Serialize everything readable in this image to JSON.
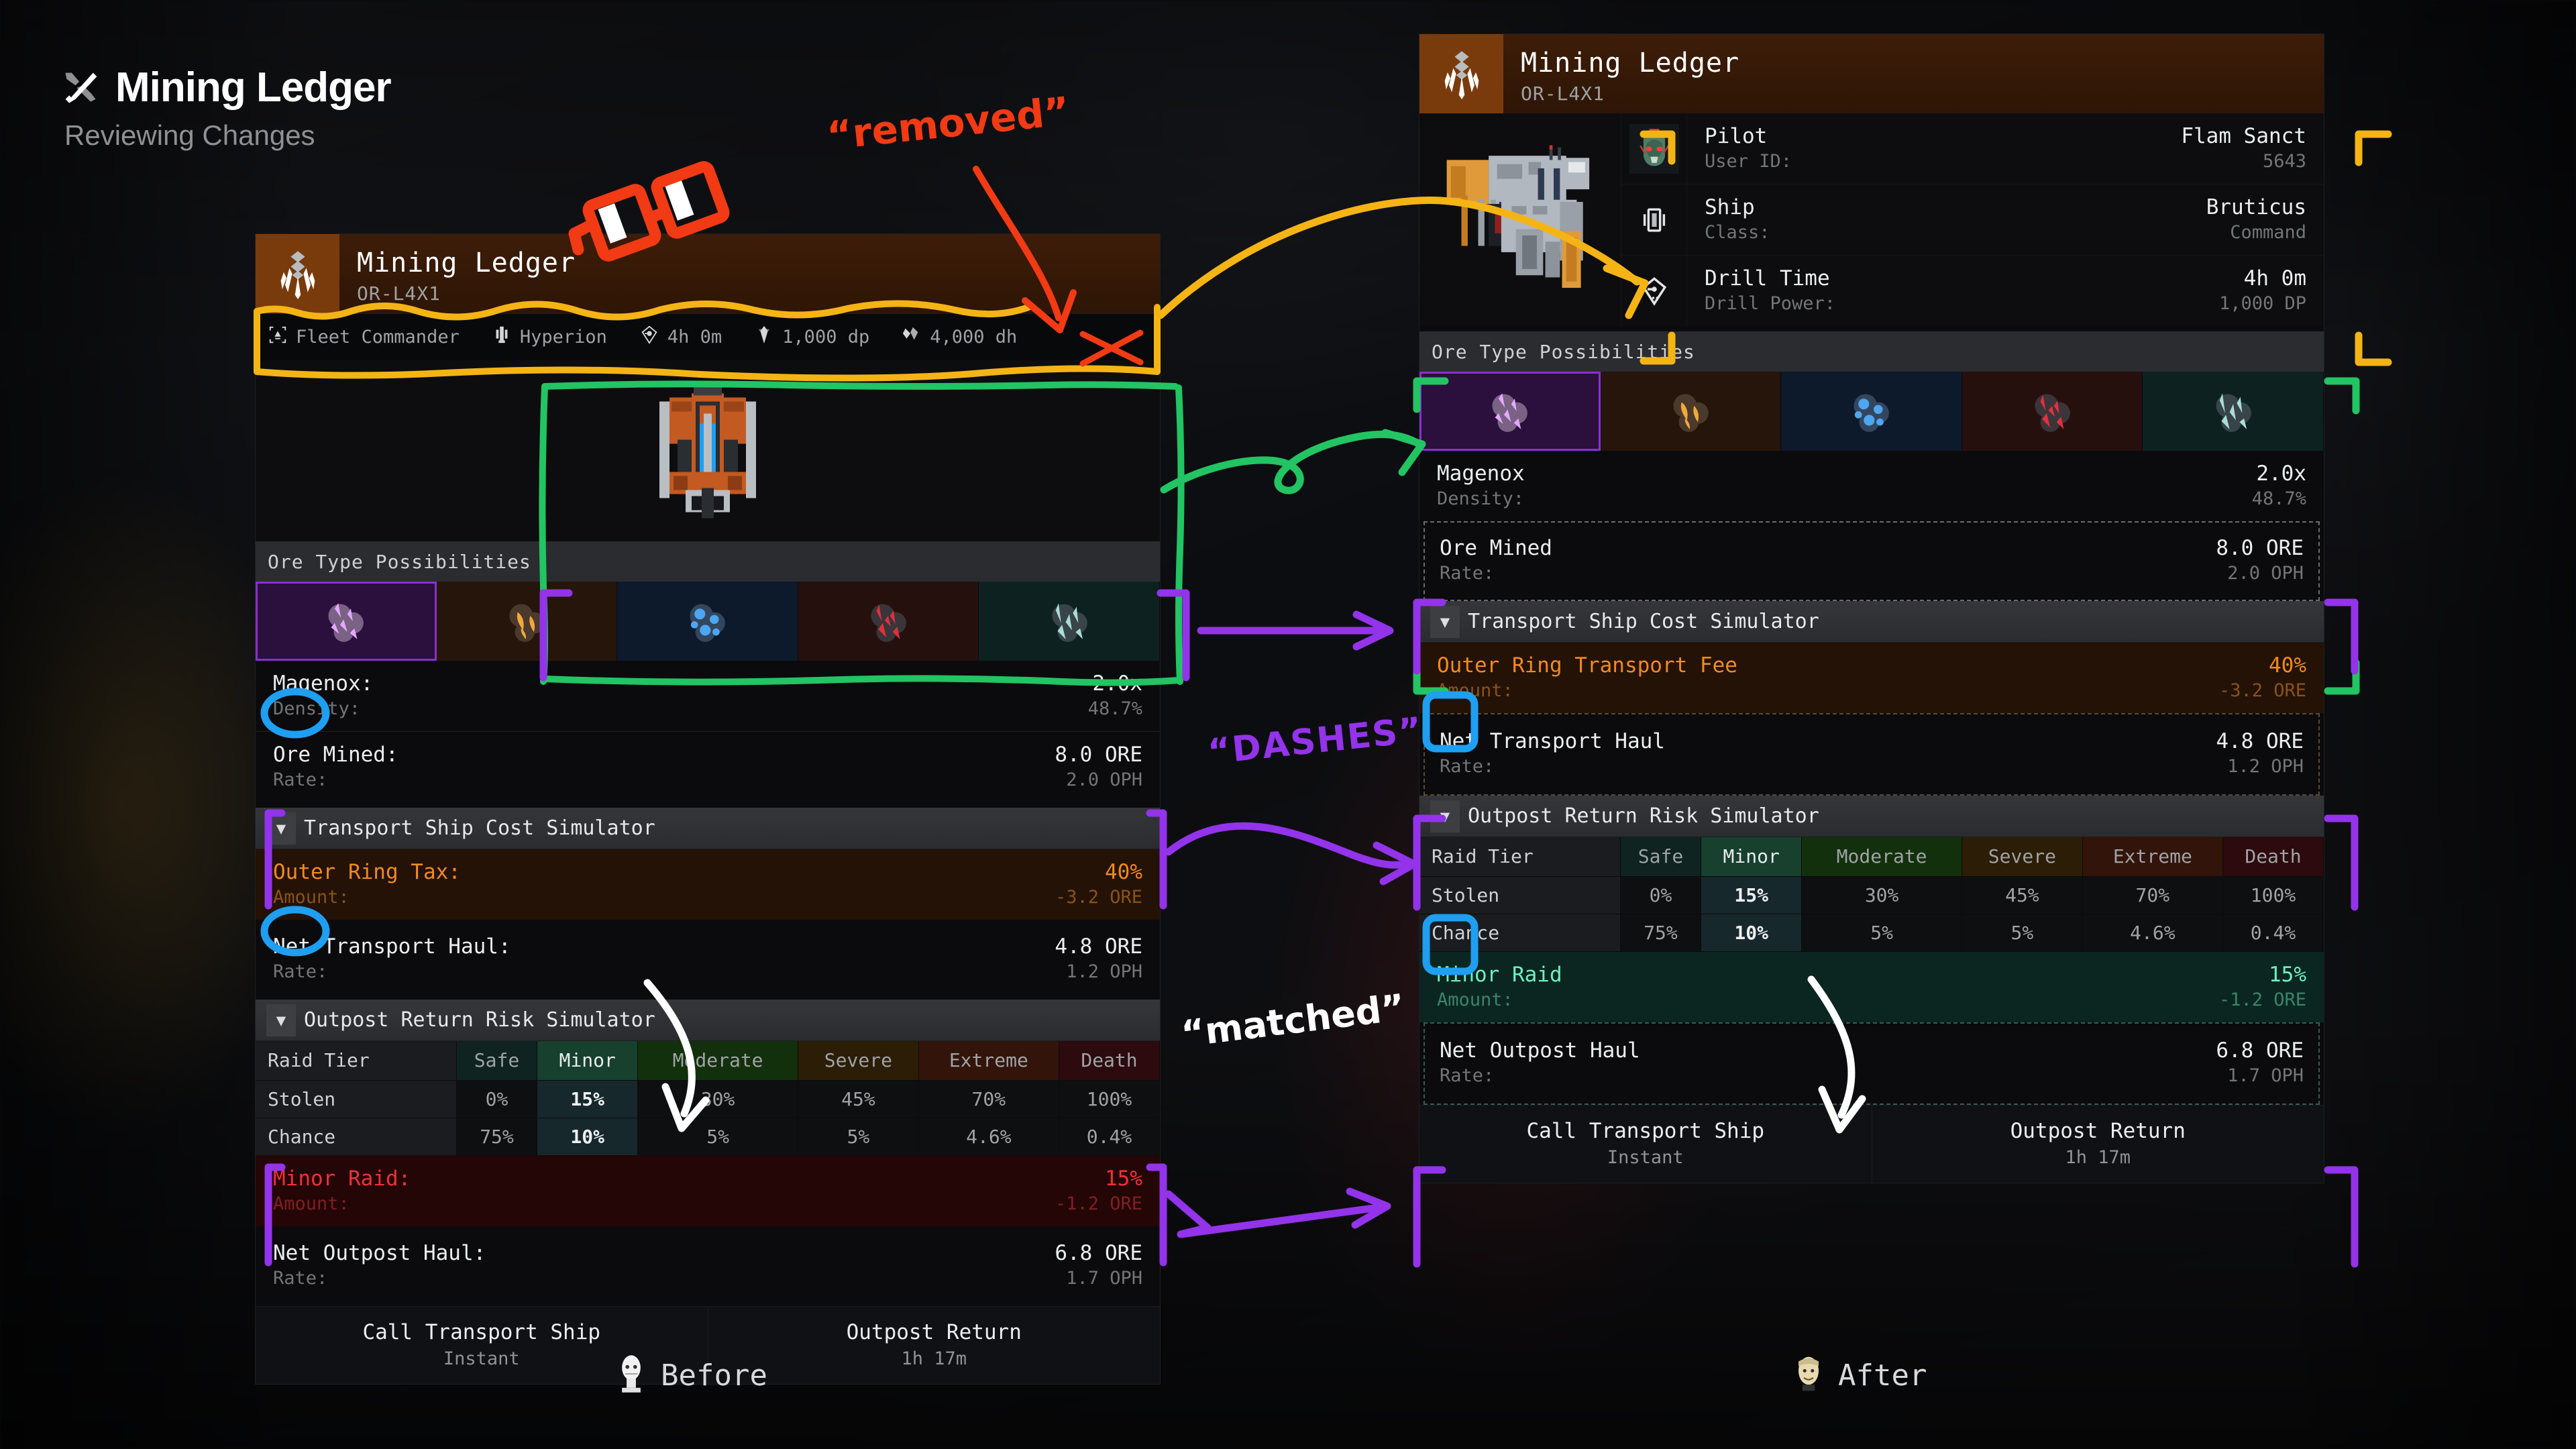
{
  "page": {
    "title": "Mining Ledger",
    "subtitle": "Reviewing Changes",
    "title_icon": "tools-icon"
  },
  "before": {
    "label": "Before",
    "icon": "ghost-statue-emoji",
    "header": {
      "title": "Mining Ledger",
      "subtitle": "OR-L4X1",
      "icon": "drill-crest-icon"
    },
    "statbar": [
      {
        "icon": "commander-badge-icon",
        "label": "Fleet Commander"
      },
      {
        "icon": "ship-icon",
        "label": "Hyperion"
      },
      {
        "icon": "drill-time-icon",
        "label": "4h 0m"
      },
      {
        "icon": "drill-power-icon",
        "label": "1,000 dp"
      },
      {
        "icon": "drill-hardness-icon",
        "label": "4,000 dh"
      }
    ],
    "ore_section": {
      "title": "Ore Type Possibilities",
      "tiles": [
        {
          "name": "magenox-ore",
          "color": "#c77ff0",
          "bg": "#2b0f3c",
          "selected": true
        },
        {
          "name": "goldrite-ore",
          "color": "#f0a93a",
          "bg": "#25150a",
          "selected": false
        },
        {
          "name": "cryovite-ore",
          "color": "#4da6f0",
          "bg": "#0d1a2c",
          "selected": false
        },
        {
          "name": "rubrex-ore",
          "color": "#e03040",
          "bg": "#26100e",
          "selected": false
        },
        {
          "name": "frostshard-ore",
          "color": "#9fd8d0",
          "bg": "#0d2220",
          "selected": false
        }
      ],
      "ore_name_label": "Magenox:",
      "ore_name_value": "2.0x",
      "density_label": "Density:",
      "density_value": "48.7%",
      "mined_label": "Ore Mined:",
      "mined_value": "8.0 ORE",
      "mined_rate_label": "Rate:",
      "mined_rate_value": "2.0 OPH"
    },
    "transport": {
      "section_title": "Transport Ship Cost Simulator",
      "fee_label": "Outer Ring Tax:",
      "fee_value": "40%",
      "amount_label": "Amount:",
      "amount_value": "-3.2 ORE",
      "net_label": "Net Transport Haul:",
      "net_value": "4.8 ORE",
      "net_rate_label": "Rate:",
      "net_rate_value": "1.2 OPH"
    },
    "risk": {
      "section_title": "Outpost Return Risk Simulator",
      "header_row": [
        "Raid Tier",
        "Safe",
        "Minor",
        "Moderate",
        "Severe",
        "Extreme",
        "Death"
      ],
      "rows": [
        {
          "label": "Stolen",
          "values": [
            "0%",
            "15%",
            "30%",
            "45%",
            "70%",
            "100%"
          ]
        },
        {
          "label": "Chance",
          "values": [
            "75%",
            "10%",
            "5%",
            "5%",
            "4.6%",
            "0.4%"
          ]
        }
      ],
      "selected_column": 2,
      "raid_label": "Minor Raid:",
      "raid_value": "15%",
      "raid_amount_label": "Amount:",
      "raid_amount_value": "-1.2 ORE",
      "net_label": "Net Outpost Haul:",
      "net_value": "6.8 ORE",
      "net_rate_label": "Rate:",
      "net_rate_value": "1.7 OPH"
    },
    "buttons": [
      {
        "label": "Call Transport Ship",
        "sub": "Instant"
      },
      {
        "label": "Outpost Return",
        "sub": "1h 17m"
      }
    ]
  },
  "after": {
    "label": "After",
    "icon": "face-emoji",
    "header": {
      "title": "Mining Ledger",
      "subtitle": "OR-L4X1",
      "icon": "drill-crest-icon"
    },
    "info_rows": [
      {
        "icon": "pilot-portrait",
        "label": "Pilot",
        "value": "Flam Sanct",
        "sub_label": "User ID:",
        "sub_value": "5643"
      },
      {
        "icon": "ship-icon",
        "label": "Ship",
        "value": "Bruticus",
        "sub_label": "Class:",
        "sub_value": "Command"
      },
      {
        "icon": "drill-time-icon",
        "label": "Drill Time",
        "value": "4h 0m",
        "sub_label": "Drill Power:",
        "sub_value": "1,000 DP"
      }
    ],
    "ore_section": {
      "title": "Ore Type Possibilities",
      "tiles": [
        {
          "name": "magenox-ore",
          "color": "#c77ff0",
          "bg": "#2b0f3c",
          "selected": true
        },
        {
          "name": "goldrite-ore",
          "color": "#f0a93a",
          "bg": "#25150a",
          "selected": false
        },
        {
          "name": "cryovite-ore",
          "color": "#4da6f0",
          "bg": "#0d1a2c",
          "selected": false
        },
        {
          "name": "rubrex-ore",
          "color": "#e03040",
          "bg": "#26100e",
          "selected": false
        },
        {
          "name": "frostshard-ore",
          "color": "#9fd8d0",
          "bg": "#0d2220",
          "selected": false
        }
      ],
      "ore_name_label": "Magenox",
      "ore_name_value": "2.0x",
      "density_label": "Density:",
      "density_value": "48.7%",
      "mined_label": "Ore Mined",
      "mined_value": "8.0 ORE",
      "mined_rate_label": "Rate:",
      "mined_rate_value": "2.0 OPH"
    },
    "transport": {
      "section_title": "Transport Ship Cost Simulator",
      "fee_label": "Outer Ring Transport Fee",
      "fee_value": "40%",
      "amount_label": "Amount:",
      "amount_value": "-3.2 ORE",
      "net_label": "Net Transport Haul",
      "net_value": "4.8 ORE",
      "net_rate_label": "Rate:",
      "net_rate_value": "1.2 OPH"
    },
    "risk": {
      "section_title": "Outpost Return Risk Simulator",
      "header_row": [
        "Raid Tier",
        "Safe",
        "Minor",
        "Moderate",
        "Severe",
        "Extreme",
        "Death"
      ],
      "rows": [
        {
          "label": "Stolen",
          "values": [
            "0%",
            "15%",
            "30%",
            "45%",
            "70%",
            "100%"
          ]
        },
        {
          "label": "Chance",
          "values": [
            "75%",
            "10%",
            "5%",
            "5%",
            "4.6%",
            "0.4%"
          ]
        }
      ],
      "selected_column": 2,
      "raid_label": "Minor Raid",
      "raid_value": "15%",
      "raid_amount_label": "Amount:",
      "raid_amount_value": "-1.2 ORE",
      "net_label": "Net Outpost Haul",
      "net_value": "6.8 ORE",
      "net_rate_label": "Rate:",
      "net_rate_value": "1.7 OPH"
    },
    "buttons": [
      {
        "label": "Call Transport Ship",
        "sub": "Instant"
      },
      {
        "label": "Outpost Return",
        "sub": "1h 17m"
      }
    ]
  },
  "annotations": {
    "removed": {
      "text": "“removed”",
      "color": "#f23a14"
    },
    "dashes": {
      "text": "“DASHES”",
      "color": "#9333ea"
    },
    "matched": {
      "text": "“matched”",
      "color": "#ffffff"
    },
    "question": {
      "text": "?",
      "color": "#ffffff"
    },
    "exclaim": {
      "text": "!!",
      "color": "#ffffff"
    },
    "colors": {
      "orange": "#f5b415",
      "green": "#22c463",
      "purple": "#9333ea",
      "blue": "#1e9ff2",
      "red": "#f23a14",
      "white": "#ffffff"
    }
  }
}
